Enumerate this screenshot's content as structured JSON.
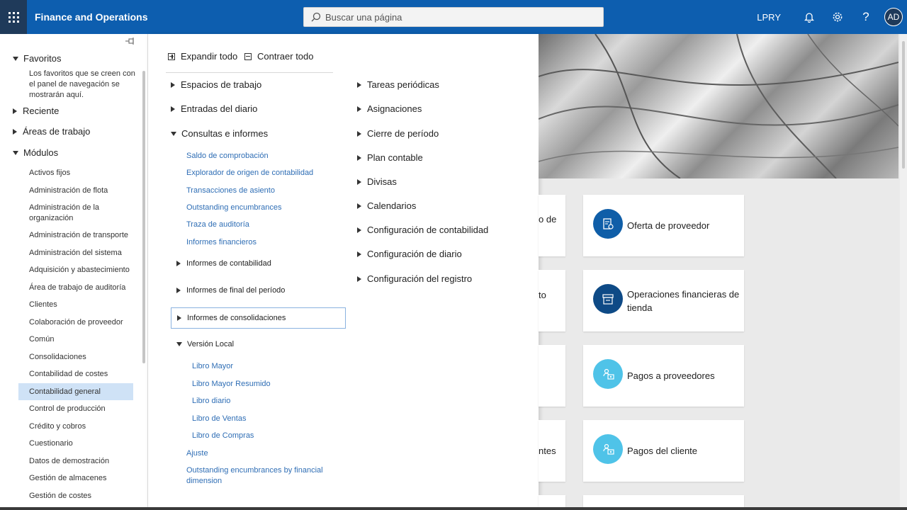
{
  "app": {
    "title": "Finance and Operations",
    "company": "LPRY",
    "avatar": "AD"
  },
  "search": {
    "placeholder": "Buscar una página"
  },
  "nav": {
    "favorites": "Favoritos",
    "favorites_note": "Los favoritos que se creen con el panel de navegación se mostrarán aquí.",
    "recent": "Reciente",
    "workspaces": "Áreas de trabajo",
    "modules": "Módulos",
    "module_items": [
      "Activos fijos",
      "Administración de flota",
      "Administración de la organización",
      "Administración de transporte",
      "Administración del sistema",
      "Adquisición y abastecimiento",
      "Área de trabajo de auditoría",
      "Clientes",
      "Colaboración de proveedor",
      "Común",
      "Consolidaciones",
      "Contabilidad de costes",
      "Contabilidad general",
      "Control de producción",
      "Crédito y cobros",
      "Cuestionario",
      "Datos de demostración",
      "Gestión de almacenes",
      "Gestión de costes"
    ]
  },
  "flyout": {
    "expand_all": "Expandir todo",
    "collapse_all": "Contraer todo",
    "col1": {
      "workspaces": "Espacios de trabajo",
      "journals": "Entradas del diario",
      "inquiries": "Consultas e informes",
      "inquiry_links": [
        "Saldo de comprobación",
        "Explorador de origen de contabilidad",
        "Transacciones de asiento",
        "Outstanding encumbrances",
        "Traza de auditoría",
        "Informes financieros"
      ],
      "ledger_reports": "Informes de contabilidad",
      "period_end_reports": "Informes de final del período",
      "consolidation_reports": "Informes de consolidaciones",
      "local_version": "Versión Local",
      "local_links": [
        "Libro Mayor",
        "Libro Mayor Resumido",
        "Libro diario",
        "Libro de Ventas",
        "Libro de Compras"
      ],
      "adjust": "Ajuste",
      "encumbrances_dim": "Outstanding encumbrances by financial dimension"
    },
    "col2": [
      "Tareas periódicas",
      "Asignaciones",
      "Cierre de período",
      "Plan contable",
      "Divisas",
      "Calendarios",
      "Configuración de contabilidad",
      "Configuración de diario",
      "Configuración del registro"
    ]
  },
  "tiles": {
    "partial": [
      "o de",
      "to",
      "ntes"
    ],
    "items": [
      {
        "label": "Oferta de proveedor",
        "icon": "vendor-quote-icon",
        "color": "#0f5ea8"
      },
      {
        "label": "Operaciones financieras de tienda",
        "icon": "store-finance-icon",
        "color": "#0e4a86"
      },
      {
        "label": "Pagos a proveedores",
        "icon": "vendor-payment-icon",
        "color": "#4fc3e8"
      },
      {
        "label": "Pagos del cliente",
        "icon": "customer-payment-icon",
        "color": "#4fc3e8"
      }
    ]
  }
}
